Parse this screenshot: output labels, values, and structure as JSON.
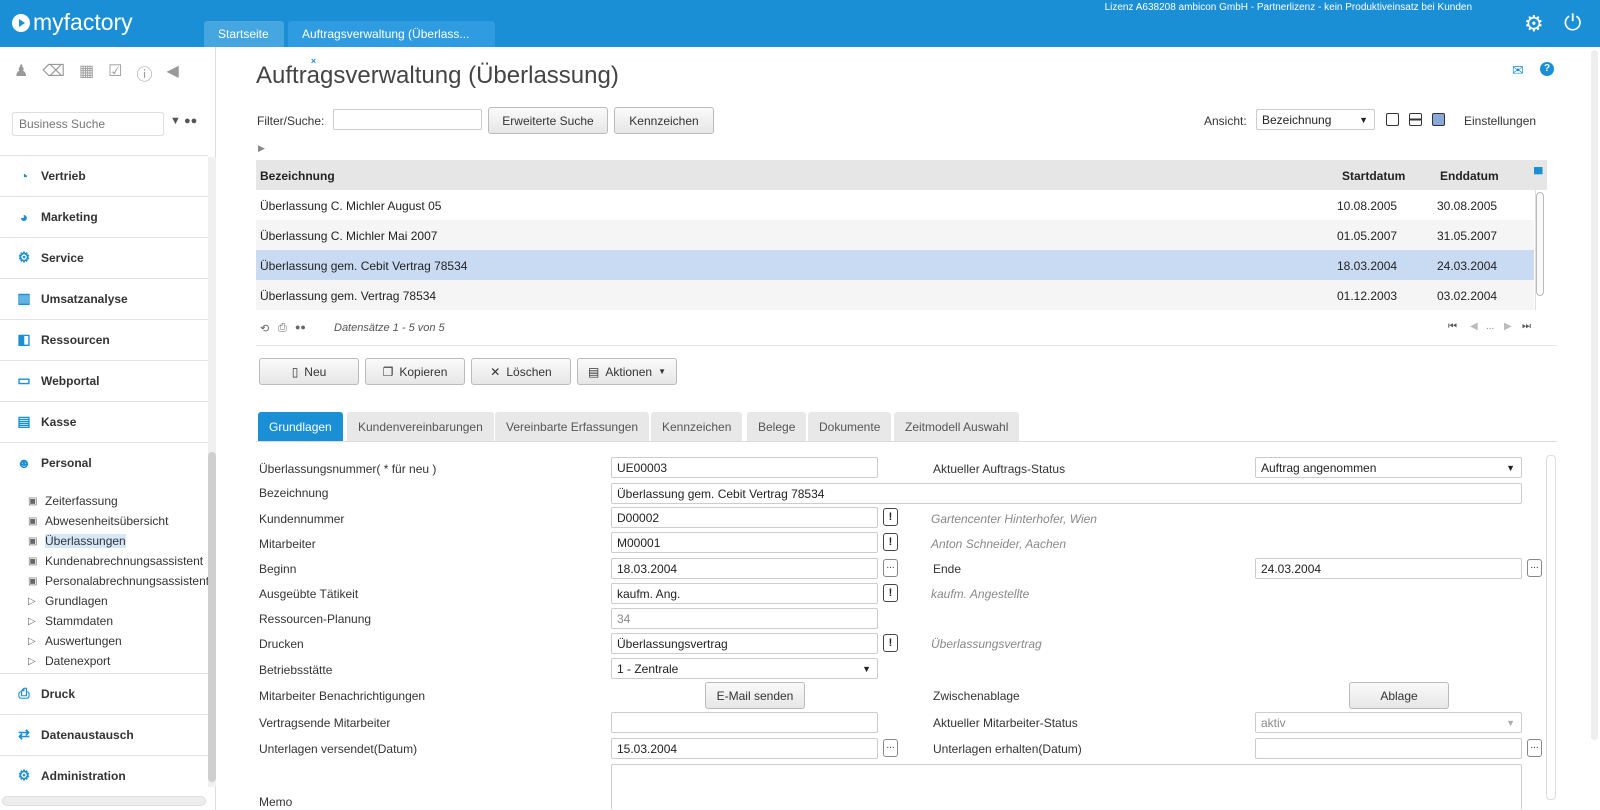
{
  "header": {
    "logo": "myfactory",
    "tabs": [
      {
        "label": "Startseite"
      },
      {
        "label": "Auftragsverwaltung (Überlass..."
      }
    ],
    "license": "Lizenz A638208 ambicon GmbH - Partnerlizenz - kein Produktiveinsatz bei Kunden"
  },
  "sidebar": {
    "search_placeholder": "Business Suche",
    "nav": [
      {
        "label": "Vertrieb",
        "icon": "chart-icon"
      },
      {
        "label": "Marketing",
        "icon": "pie-icon"
      },
      {
        "label": "Service",
        "icon": "gear-icon"
      },
      {
        "label": "Umsatzanalyse",
        "icon": "bar-chart-icon"
      },
      {
        "label": "Ressourcen",
        "icon": "share-icon"
      },
      {
        "label": "Webportal",
        "icon": "browser-icon"
      },
      {
        "label": "Kasse",
        "icon": "register-icon"
      },
      {
        "label": "Personal",
        "icon": "people-icon"
      },
      {
        "label": "Druck",
        "icon": "printer-icon"
      },
      {
        "label": "Datenaustausch",
        "icon": "exchange-icon"
      },
      {
        "label": "Administration",
        "icon": "gear-icon"
      }
    ],
    "sub_items": [
      {
        "label": "Zeiterfassung",
        "icon": "window"
      },
      {
        "label": "Abwesenheitsübersicht",
        "icon": "window"
      },
      {
        "label": "Überlassungen",
        "icon": "window"
      },
      {
        "label": "Kundenabrechnungsassistent",
        "icon": "window"
      },
      {
        "label": "Personalabrechnungsassistent",
        "icon": "window"
      },
      {
        "label": "Grundlagen",
        "icon": "triangle"
      },
      {
        "label": "Stammdaten",
        "icon": "triangle"
      },
      {
        "label": "Auswertungen",
        "icon": "triangle"
      },
      {
        "label": "Datenexport",
        "icon": "triangle"
      }
    ]
  },
  "page": {
    "title": "Auftragsverwaltung (Überlassung)",
    "filter_label": "Filter/Suche:",
    "filter_value": "",
    "btn_extended_search": "Erweiterte Suche",
    "btn_kennzeichen": "Kennzeichen",
    "view_label": "Ansicht:",
    "view_value": "Bezeichnung",
    "settings": "Einstellungen"
  },
  "grid": {
    "columns": [
      "Bezeichnung",
      "Startdatum",
      "Enddatum"
    ],
    "rows": [
      {
        "name": "Überlassung C. Michler August 05",
        "start": "10.08.2005",
        "end": "30.08.2005"
      },
      {
        "name": "Überlassung C. Michler Mai 2007",
        "start": "01.05.2007",
        "end": "31.05.2007"
      },
      {
        "name": "Überlassung gem. Cebit Vertrag 78534",
        "start": "18.03.2004",
        "end": "24.03.2004"
      },
      {
        "name": "Überlassung gem. Vertrag 78534",
        "start": "01.12.2003",
        "end": "03.02.2004"
      }
    ],
    "footer": "Datensätze 1 - 5 von 5",
    "pager_ellipsis": "..."
  },
  "actions": {
    "new": "Neu",
    "copy": "Kopieren",
    "delete": "Löschen",
    "actions": "Aktionen"
  },
  "form_tabs": [
    "Grundlagen",
    "Kundenvereinbarungen",
    "Vereinbarte Erfassungen",
    "Kennzeichen",
    "Belege",
    "Dokumente",
    "Zeitmodell Auswahl"
  ],
  "form": {
    "nummer_label": "Überlassungsnummer( * für neu )",
    "nummer": "UE00003",
    "status_label": "Aktueller Auftrags-Status",
    "status": "Auftrag angenommen",
    "bezeichnung_label": "Bezeichnung",
    "bezeichnung": "Überlassung gem. Cebit Vertrag 78534",
    "kunde_label": "Kundennummer",
    "kunde": "D00002",
    "kunde_hint": "Gartencenter Hinterhofer, Wien",
    "mitarbeiter_label": "Mitarbeiter",
    "mitarbeiter": "M00001",
    "mitarbeiter_hint": "Anton Schneider, Aachen",
    "beginn_label": "Beginn",
    "beginn": "18.03.2004",
    "ende_label": "Ende",
    "ende": "24.03.2004",
    "taetigkeit_label": "Ausgeübte Tätikeit",
    "taetigkeit": "kaufm. Ang.",
    "taetigkeit_hint": "kaufm. Angestellte",
    "planung_label": "Ressourcen-Planung",
    "planung": "34",
    "drucken_label": "Drucken",
    "drucken": "Überlassungsvertrag",
    "drucken_hint": "Überlassungsvertrag",
    "betrieb_label": "Betriebsstätte",
    "betrieb": "1 - Zentrale",
    "benach_label": "Mitarbeiter Benachrichtigungen",
    "email_btn": "E-Mail senden",
    "zwischen_label": "Zwischenablage",
    "ablage_btn": "Ablage",
    "vertragsende_label": "Vertragsende Mitarbeiter",
    "vertragsende": "",
    "ma_status_label": "Aktueller Mitarbeiter-Status",
    "ma_status": "aktiv",
    "versendet_label": "Unterlagen versendet(Datum)",
    "versendet": "15.03.2004",
    "erhalten_label": "Unterlagen erhalten(Datum)",
    "erhalten": "",
    "memo_label": "Memo",
    "memo": ""
  }
}
